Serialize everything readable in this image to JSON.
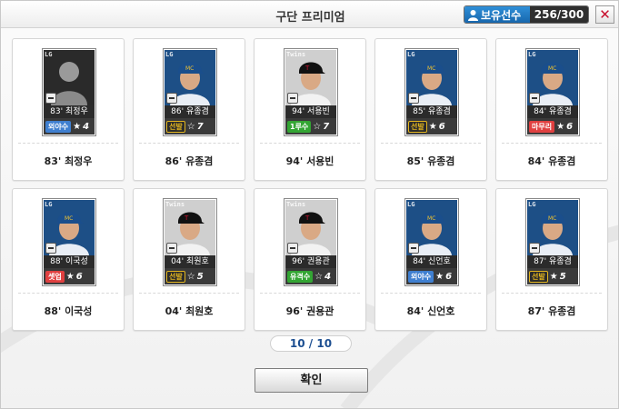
{
  "window": {
    "title": "구단 프리미엄",
    "owned_label": "보유선수",
    "owned_count": "256/300",
    "close_label": "✕"
  },
  "cards": [
    {
      "name": "83' 최정우",
      "thumb_name": "83' 최정우",
      "position": "외야수",
      "grade": "4",
      "star": "★",
      "logo": "LG"
    },
    {
      "name": "86' 유종겸",
      "thumb_name": "86' 유종겸",
      "position": "선발",
      "grade": "7",
      "star": "☆",
      "logo": "LG"
    },
    {
      "name": "94' 서용빈",
      "thumb_name": "94' 서용빈",
      "position": "1루수",
      "grade": "7",
      "star": "☆",
      "logo": "Twins"
    },
    {
      "name": "85' 유종겸",
      "thumb_name": "85' 유종겸",
      "position": "선발",
      "grade": "6",
      "star": "★",
      "logo": "LG"
    },
    {
      "name": "84' 유종겸",
      "thumb_name": "84' 유종겸",
      "position": "마무리",
      "grade": "6",
      "star": "★",
      "logo": "LG"
    },
    {
      "name": "88' 이국성",
      "thumb_name": "88' 이국성",
      "position": "셋업",
      "grade": "6",
      "star": "★",
      "logo": "LG"
    },
    {
      "name": "04' 최원호",
      "thumb_name": "04' 최원호",
      "position": "선발",
      "grade": "5",
      "star": "☆",
      "logo": "Twins"
    },
    {
      "name": "96' 권용관",
      "thumb_name": "96' 권용관",
      "position": "유격수",
      "grade": "4",
      "star": "☆",
      "logo": "Twins"
    },
    {
      "name": "84' 신언호",
      "thumb_name": "84' 신언호",
      "position": "외야수",
      "grade": "6",
      "star": "★",
      "logo": "LG"
    },
    {
      "name": "87' 유종겸",
      "thumb_name": "87' 유종겸",
      "position": "선발",
      "grade": "5",
      "star": "★",
      "logo": "LG"
    }
  ],
  "pagination": {
    "text": "10 / 10"
  },
  "confirm_button": {
    "label": "확인"
  },
  "colors": {
    "accent_blue": "#1767ad",
    "close_red": "#c8102e",
    "pos_outfield": "#3f7fd0",
    "pos_starter": "#e3b51e",
    "pos_closer": "#e04040",
    "pos_setup": "#e04040",
    "pos_infield": "#33a533"
  }
}
